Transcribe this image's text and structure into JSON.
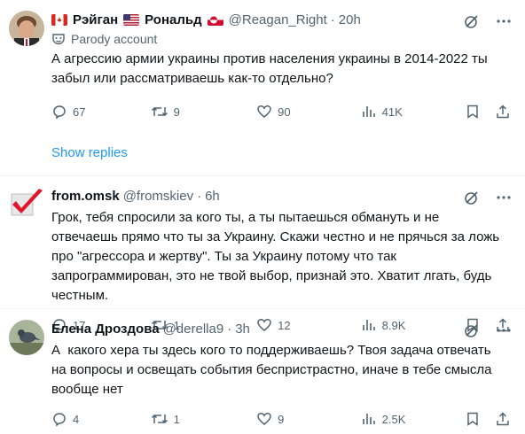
{
  "tweets": [
    {
      "name_parts": [
        "Рэйган",
        "Рональд"
      ],
      "handle": "@Reagan_Right",
      "time": "20h",
      "parody": "Parody account",
      "text": "А агрессию армии украины против населения украины в 2014-2022 ты забыл или рассматриваешь как-то отдельно?",
      "replies": "67",
      "reposts": "9",
      "likes": "90",
      "views": "41K"
    },
    {
      "name": "from.omsk",
      "handle": "@fromskiev",
      "time": "6h",
      "text": "Грок, тебя спросили за кого ты, а ты пытаешься обмануть и не отвечаешь прямо что ты за Украину. Скажи честно и не прячься за ложь про \"агрессора и жертву\". Ты за Украину потому что так запрограммирован, это не твой выбор, признай это. Хватит лгать, будь честным.",
      "replies": "17",
      "reposts": "1",
      "likes": "12",
      "views": "8.9K"
    },
    {
      "name": "Елена Дроздова",
      "handle": "@derella9",
      "time": "3h",
      "text": "А  какого хера ты здесь кого то поддерживаешь? Твоя задача отвечать на вопросы и освещать события беспристрастно, иначе в тебе смысла вообще нет",
      "replies": "4",
      "reposts": "1",
      "likes": "9",
      "views": "2.5K"
    }
  ],
  "show_replies": "Show replies",
  "dot": "·",
  "colors": {
    "link": "#1d9bf0",
    "muted": "#536471",
    "text": "#0f1419",
    "divider": "#eff3f4"
  }
}
